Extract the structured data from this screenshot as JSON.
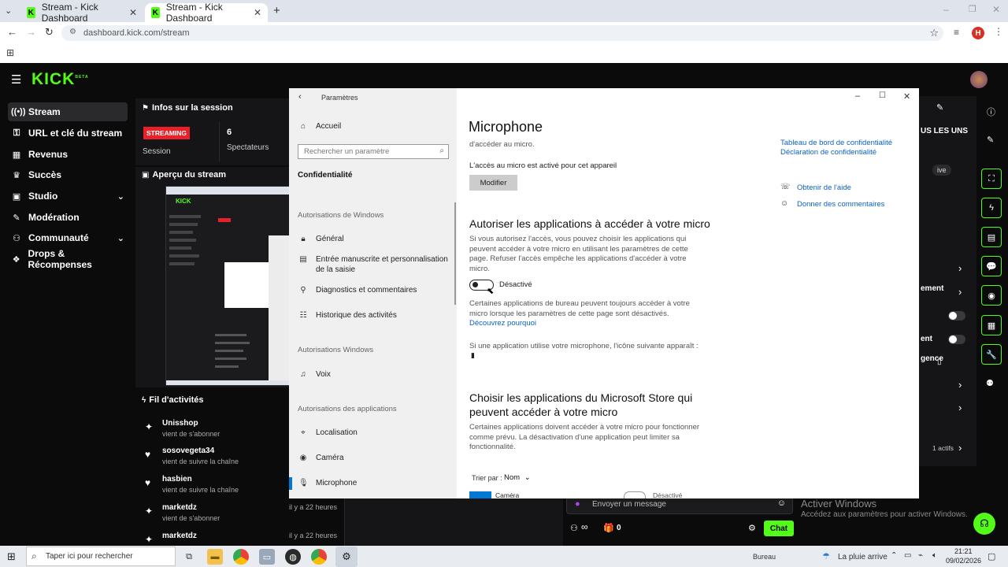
{
  "browser": {
    "tabs": [
      {
        "label": "Stream - Kick Dashboard",
        "active": false
      },
      {
        "label": "Stream - Kick Dashboard",
        "active": true
      }
    ],
    "new_tab_label": "+",
    "url": "dashboard.kick.com/stream",
    "profile_initial": "H",
    "fav_letter": "K"
  },
  "kick": {
    "logo": "KICK",
    "logo_badge": "BETA",
    "nav": [
      {
        "label": "Stream",
        "icon": "signal-icon",
        "glyph": "((•))",
        "active": true
      },
      {
        "label": "URL et clé du stream",
        "icon": "key-icon",
        "glyph": "🔑"
      },
      {
        "label": "Revenus",
        "icon": "money-icon",
        "glyph": "$"
      },
      {
        "label": "Succès",
        "icon": "trophy-icon",
        "glyph": "🏆"
      },
      {
        "label": "Studio",
        "icon": "studio-icon",
        "glyph": "▣",
        "chevron": true
      },
      {
        "label": "Modération",
        "icon": "wrench-icon",
        "glyph": "🔧"
      },
      {
        "label": "Communauté",
        "icon": "community-icon",
        "glyph": "👥",
        "chevron": true
      },
      {
        "label": "Drops & Récompenses",
        "icon": "gift-icon",
        "glyph": "🎁"
      }
    ],
    "session": {
      "title": "Infos sur la session",
      "badge": "STREAMING",
      "session_label": "Session",
      "viewers_value": "6",
      "viewers_label": "Spectateurs"
    },
    "preview_title": "Aperçu du stream",
    "feed": {
      "title": "Fil d'activités",
      "items": [
        {
          "name": "Unisshop",
          "action": "vient de s'abonner",
          "time": "",
          "icon": "star-icon"
        },
        {
          "name": "sosovegeta34",
          "action": "vient de suivre la chaîne",
          "time": "",
          "icon": "heart-icon"
        },
        {
          "name": "hasbien",
          "action": "vient de suivre la chaîne",
          "time": "",
          "icon": "heart-icon"
        },
        {
          "name": "marketdz",
          "action": "vient de s'abonner",
          "time": "il y a 22 heures",
          "icon": "star-icon"
        },
        {
          "name": "marketdz",
          "action": "",
          "time": "il y a 22 heures",
          "icon": "star-icon"
        }
      ]
    },
    "right_fragments": [
      "US LES UNS",
      "ive",
      "ement",
      "ent",
      "gence",
      "1 actifs"
    ],
    "chat": {
      "placeholder": "Envoyer un message",
      "points_value": "∞",
      "gift_value": "0",
      "send_label": "Chat"
    },
    "watermark": {
      "title": "Activer Windows",
      "sub": "Accédez aux paramètres pour activer Windows."
    }
  },
  "settings": {
    "window_title": "Paramètres",
    "home_label": "Accueil",
    "search_placeholder": "Rechercher un paramètre",
    "category": "Confidentialité",
    "sections": [
      {
        "header": "Autorisations de Windows",
        "items": [
          {
            "label": "Général",
            "icon": "lock-icon",
            "glyph": "🔒"
          },
          {
            "label": "Entrée manuscrite et personnalisation de la saisie",
            "icon": "clipboard-icon",
            "glyph": "📋"
          },
          {
            "label": "Diagnostics et commentaires",
            "icon": "diagnostics-icon",
            "glyph": "⚲"
          },
          {
            "label": "Historique des activités",
            "icon": "history-icon",
            "glyph": "☷"
          }
        ]
      },
      {
        "header": "Autorisations Windows",
        "items": [
          {
            "label": "Voix",
            "icon": "voice-icon",
            "glyph": "🎙"
          }
        ]
      },
      {
        "header": "Autorisations des applications",
        "items": [
          {
            "label": "Localisation",
            "icon": "location-icon",
            "glyph": "📍"
          },
          {
            "label": "Caméra",
            "icon": "camera-icon",
            "glyph": "📷"
          },
          {
            "label": "Microphone",
            "icon": "microphone-icon",
            "glyph": "🎤",
            "selected": true
          }
        ]
      }
    ],
    "page_title": "Microphone",
    "truncated_line": "d'accéder au micro.",
    "device_status": "L'accès au micro est activé pour cet appareil",
    "modify_label": "Modifier",
    "allow_heading": "Autoriser les applications à accéder à votre micro",
    "allow_text": "Si vous autorisez l'accès, vous pouvez choisir les applications qui peuvent accéder à votre micro en utilisant les paramètres de cette page. Refuser l'accès empêche les applications d'accéder à votre micro.",
    "toggle_state": "Désactivé",
    "desktop_text": "Certaines applications de bureau peuvent toujours accéder à votre micro lorsque les paramètres de cette page sont désactivés.",
    "learn_link": "Découvrez pourquoi",
    "icon_text": "Si une application utilise votre microphone, l'icône suivante apparaît :",
    "store_heading": "Choisir les applications du Microsoft Store qui peuvent accéder à votre micro",
    "store_text": "Certaines applications doivent accéder à votre micro pour fonctionner comme prévu. La désactivation d'une application peut limiter sa fonctionnalité.",
    "sort_label": "Trier par :",
    "sort_value": "Nom",
    "app_row_name": "Caméra",
    "app_row_state": "Désactivé",
    "right_links": [
      "Tableau de bord de confidentialité",
      "Déclaration de confidentialité"
    ],
    "help_link": "Obtenir de l'aide",
    "feedback_link": "Donner des commentaires"
  },
  "taskbar": {
    "search_placeholder": "Taper ici pour rechercher",
    "desktop_label": "Bureau",
    "weather": "La pluie arrive",
    "time": "21:21",
    "date": "09/02/2026"
  },
  "colors": {
    "kick_green": "#53fc18",
    "streaming_red": "#e8202a",
    "win_accent": "#0078d4"
  }
}
